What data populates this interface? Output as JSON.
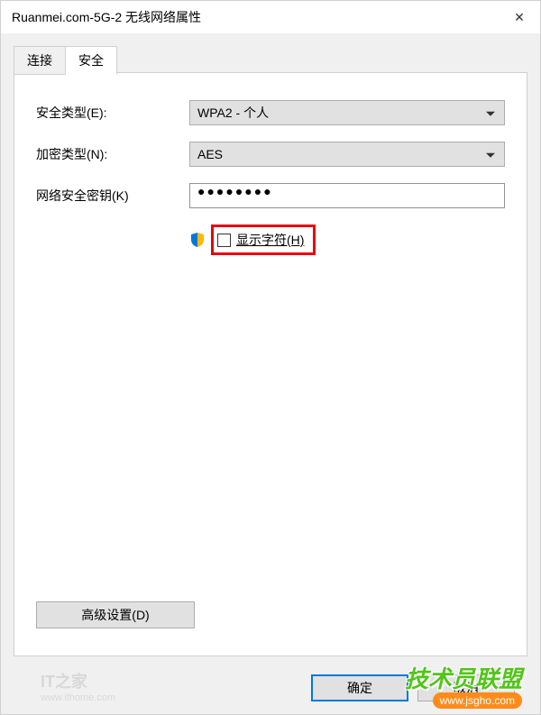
{
  "window": {
    "title": "Ruanmei.com-5G-2 无线网络属性",
    "close": "✕"
  },
  "tabs": {
    "connect": "连接",
    "security": "安全"
  },
  "form": {
    "security_type_label": "安全类型(E):",
    "security_type_value": "WPA2 - 个人",
    "encryption_label": "加密类型(N):",
    "encryption_value": "AES",
    "key_label": "网络安全密钥(K)",
    "key_value": "●●●●●●●●",
    "show_chars_label": "显示字符(H)"
  },
  "buttons": {
    "advanced": "高级设置(D)",
    "ok": "确定",
    "cancel": "取消"
  },
  "watermark": {
    "left_logo": "IT之家",
    "left_url": "www.ithome.com",
    "right_text": "技术员联盟",
    "right_url": "www.jsgho.com"
  }
}
